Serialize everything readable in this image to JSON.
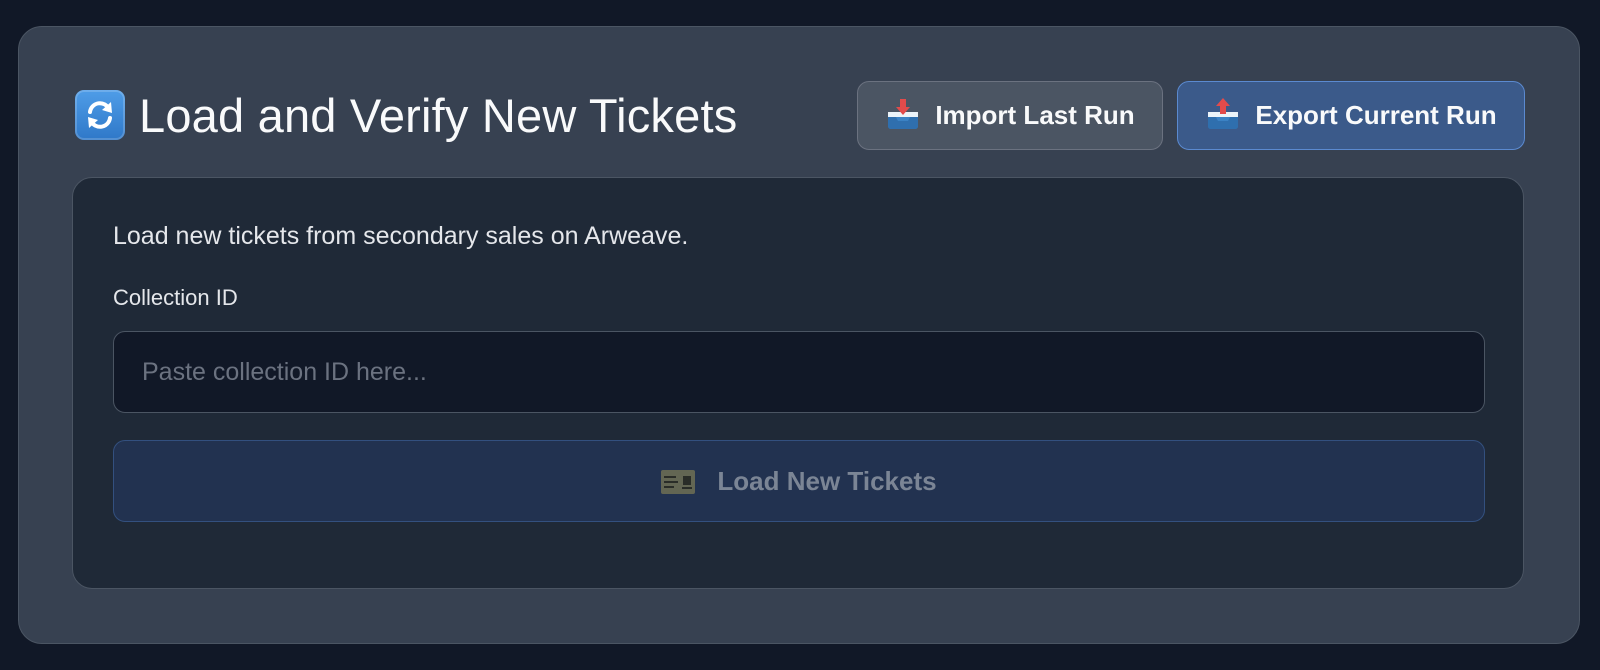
{
  "header": {
    "title": "Load and Verify New Tickets",
    "title_icon": "refresh-icon",
    "import_button": {
      "label": "Import Last Run",
      "icon": "inbox-tray-icon"
    },
    "export_button": {
      "label": "Export Current Run",
      "icon": "outbox-tray-icon"
    }
  },
  "card": {
    "description": "Load new tickets from secondary sales on Arweave.",
    "field_label": "Collection ID",
    "input": {
      "value": "",
      "placeholder": "Paste collection ID here..."
    },
    "load_button": {
      "label": "Load New Tickets",
      "icon": "ticket-icon",
      "enabled": false
    }
  },
  "colors": {
    "background": "#111827",
    "panel": "#374151",
    "card": "#1f2937",
    "export_accent": "#3b5a8a",
    "load_button_bg": "#223250"
  }
}
